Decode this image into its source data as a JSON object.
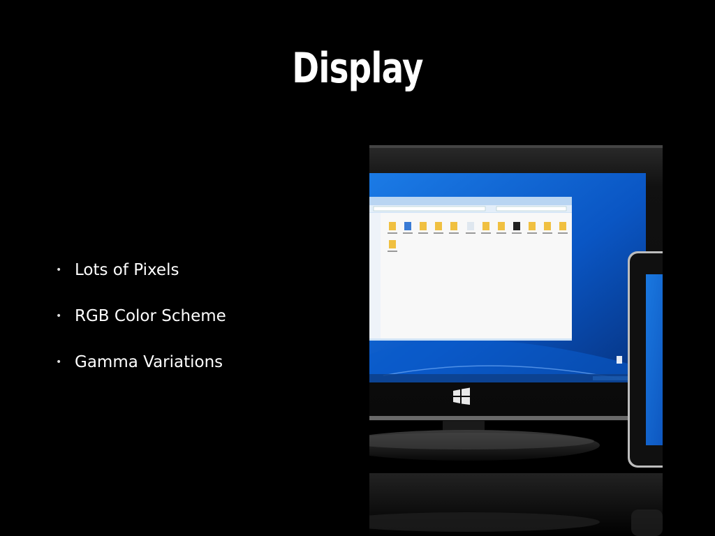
{
  "slide": {
    "title": "Display",
    "bullets": [
      "Lots of Pixels",
      "RGB Color Scheme",
      "Gamma Variations"
    ]
  },
  "image": {
    "subject": "monitor-and-tablet",
    "colors": {
      "desktop_blue": "#0b5fd0",
      "bezel": "#141414",
      "window": "#f7f7f7"
    }
  }
}
